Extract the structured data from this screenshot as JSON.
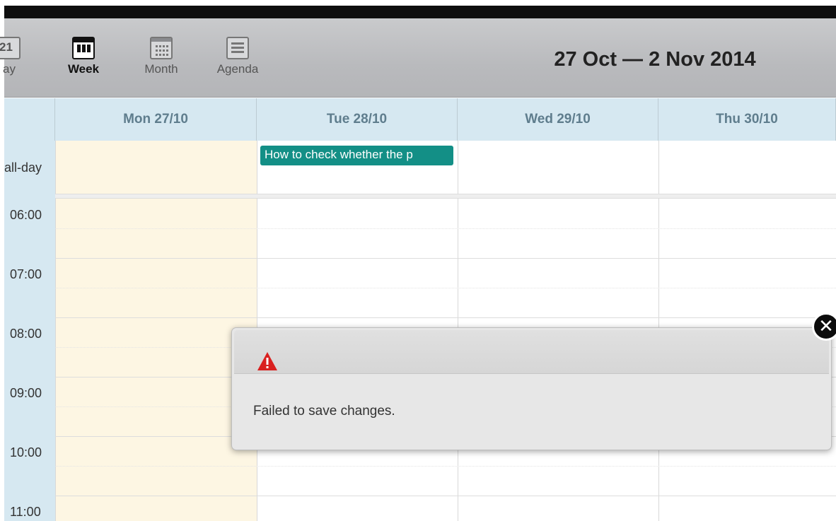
{
  "toolbar": {
    "views": [
      {
        "label": "Day",
        "icon": "calendar-day-icon",
        "icon_text": "21",
        "shown_label": "ay"
      },
      {
        "label": "Week",
        "icon": "calendar-week-icon",
        "active": true
      },
      {
        "label": "Month",
        "icon": "calendar-month-icon"
      },
      {
        "label": "Agenda",
        "icon": "agenda-list-icon"
      }
    ],
    "range_title": "27 Oct — 2 Nov 2014"
  },
  "calendar": {
    "columns": [
      "Mon 27/10",
      "Tue 28/10",
      "Wed 29/10",
      "Thu 30/10"
    ],
    "allday_label": "all-day",
    "times": [
      "06:00",
      "07:00",
      "08:00",
      "09:00",
      "10:00",
      "11:00"
    ],
    "event": {
      "title": "How to check whether the p",
      "color": "#138f86"
    }
  },
  "dialog": {
    "icon": "warning-icon",
    "message": "Failed to save changes.",
    "close_icon": "close-icon"
  },
  "colors": {
    "header_bg": "#d6e8f1",
    "today_bg": "#fdf6e3",
    "warning": "#d9201f"
  }
}
